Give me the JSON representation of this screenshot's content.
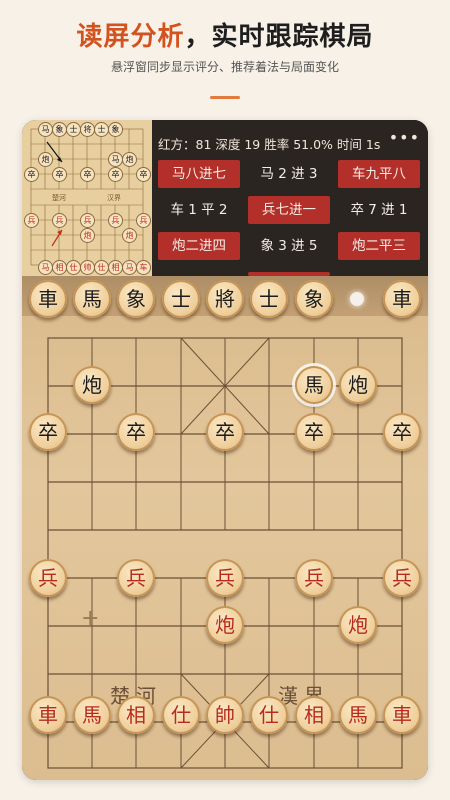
{
  "hero": {
    "title_accent": "读屏分析",
    "title_rest": "，实时跟踪棋局",
    "subtitle": "悬浮窗同步显示评分、推荐着法与局面变化"
  },
  "analysis": {
    "stats": "红方：81 深度 19 胜率 51.0% 时间 1s",
    "more_icon": "more-dots-icon",
    "more_glyph": "•••",
    "moves": [
      {
        "label": "马八进七",
        "highlight": true
      },
      {
        "label": "马 2 进 3",
        "highlight": false
      },
      {
        "label": "车九平八",
        "highlight": true
      },
      {
        "label": "车 1 平 2",
        "highlight": false
      },
      {
        "label": "兵七进一",
        "highlight": true
      },
      {
        "label": "卒 7 进 1",
        "highlight": false
      },
      {
        "label": "炮二进四",
        "highlight": true
      },
      {
        "label": "象 3 进 5",
        "highlight": false
      },
      {
        "label": "炮二平三",
        "highlight": true
      }
    ]
  },
  "mini_board": {
    "river_left": "楚河",
    "river_right": "汉界",
    "black_pieces": [
      "马",
      "象",
      "士",
      "将",
      "士",
      "象",
      "马",
      "炮",
      "马",
      "炮",
      "卒",
      "卒",
      "卒",
      "卒",
      "卒"
    ],
    "red_pieces": [
      "兵",
      "兵",
      "兵",
      "兵",
      "兵",
      "炮",
      "炮",
      "马",
      "相",
      "仕",
      "帅",
      "仕",
      "相",
      "马",
      "车"
    ]
  },
  "board": {
    "river_left": "楚河",
    "river_right": "漢界",
    "black_back_row": [
      "車",
      "馬",
      "象",
      "士",
      "將",
      "士",
      "象",
      "車"
    ],
    "black_cannons": [
      "炮",
      "馬",
      "炮"
    ],
    "black_soldiers": [
      "卒",
      "卒",
      "卒",
      "卒",
      "卒"
    ],
    "red_soldiers": [
      "兵",
      "兵",
      "兵",
      "兵",
      "兵"
    ],
    "red_cannons": [
      "炮",
      "炮"
    ],
    "red_back_row": [
      "車",
      "馬",
      "相",
      "仕",
      "帥",
      "仕",
      "相",
      "馬",
      "車"
    ]
  }
}
